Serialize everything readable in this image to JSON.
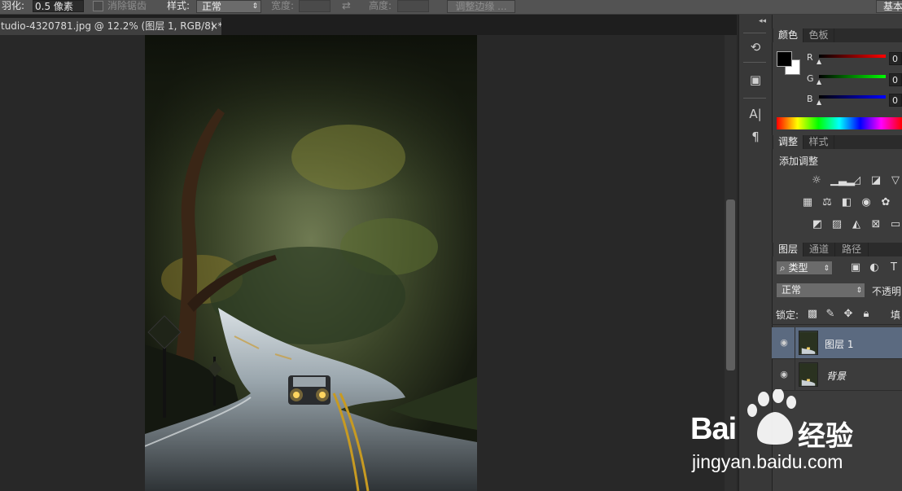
{
  "options_bar": {
    "feather_label": "羽化:",
    "feather_value": "0.5 像素",
    "antialias_label": "消除锯齿",
    "style_label": "样式:",
    "style_value": "正常",
    "width_label": "宽度:",
    "height_label": "高度:",
    "refine_edge_label": "调整边缘 ...",
    "workspace_label": "基本"
  },
  "document_tab": {
    "title": "tudio-4320781.jpg @ 12.2% (图层 1, RGB/8) *",
    "close": "×"
  },
  "tool_strip": {
    "collapse": "◂◂",
    "icons": [
      "history-icon",
      "properties-icon",
      "character-icon",
      "paragraph-icon"
    ]
  },
  "color_panel": {
    "tabs": [
      "颜色",
      "色板"
    ],
    "foreground": "#000000",
    "background": "#ffffff",
    "channels": [
      {
        "label": "R",
        "value": "0",
        "color": "#d21a1a"
      },
      {
        "label": "G",
        "value": "0",
        "color": "#18b218"
      },
      {
        "label": "B",
        "value": "0",
        "color": "#1a1ad2"
      }
    ]
  },
  "adjustments_panel": {
    "tabs": [
      "调整",
      "样式"
    ],
    "title": "添加调整",
    "icons_row1": [
      "brightness-icon",
      "levels-icon",
      "curves-icon",
      "exposure-icon",
      "vibrance-icon"
    ],
    "icons_row2": [
      "hue-saturation-icon",
      "color-balance-icon",
      "black-white-icon",
      "photo-filter-icon",
      "channel-mixer-icon"
    ],
    "icons_row3": [
      "invert-icon",
      "posterize-icon",
      "threshold-icon",
      "selective-color-icon",
      "gradient-map-icon"
    ]
  },
  "layers_panel": {
    "tabs": [
      "图层",
      "通道",
      "路径"
    ],
    "filter_label": "类型",
    "blend_mode": "正常",
    "opacity_label": "不透明",
    "lock_label": "锁定:",
    "fill_label": "填",
    "layers": [
      {
        "name": "图层 1",
        "selected": true
      },
      {
        "name": "背景",
        "selected": false
      }
    ]
  },
  "watermark": {
    "brand": "Bai",
    "brand_suffix": "经验",
    "url": "jingyan.baidu.com"
  },
  "colors": {
    "selected_layer": "#5b6a80",
    "panel": "#3c3c3c"
  }
}
